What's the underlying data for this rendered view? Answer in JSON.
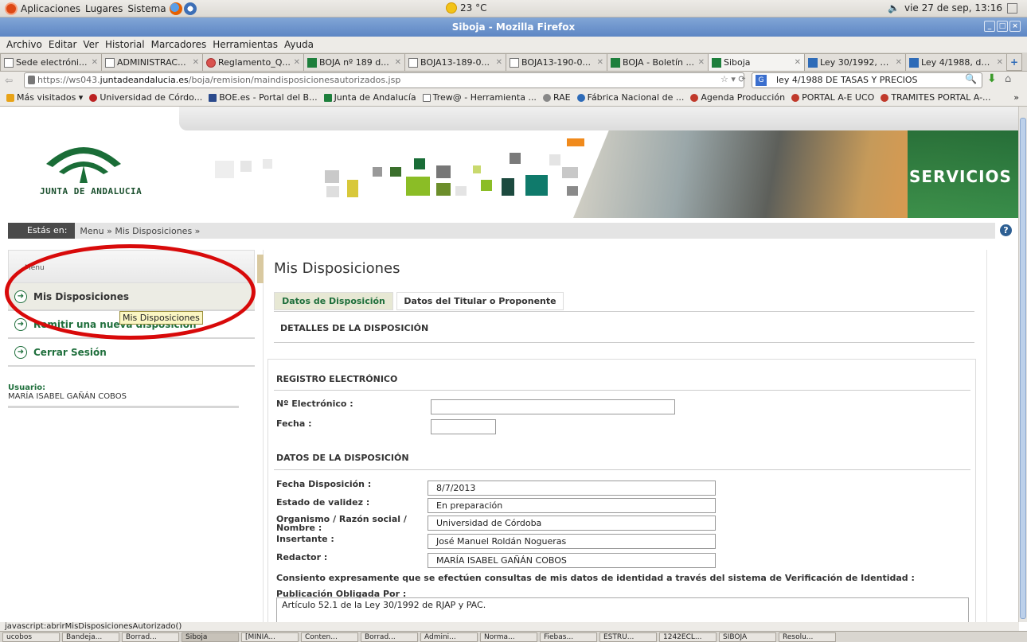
{
  "panel": {
    "menus": [
      "Aplicaciones",
      "Lugares",
      "Sistema"
    ],
    "weather": "23 °C",
    "clock": "vie 27 de sep, 13:16"
  },
  "window": {
    "title": "Siboja - Mozilla Firefox"
  },
  "menubar": [
    "Archivo",
    "Editar",
    "Ver",
    "Historial",
    "Marcadores",
    "Herramientas",
    "Ayuda"
  ],
  "tabs": [
    {
      "label": "Sede electróni...",
      "icon": "page"
    },
    {
      "label": "ADMINISTRAC...",
      "icon": "page"
    },
    {
      "label": "Reglamento_Q...",
      "icon": "pdf"
    },
    {
      "label": "BOJA nº 189 d...",
      "icon": "junta"
    },
    {
      "label": "BOJA13-189-0...",
      "icon": "page"
    },
    {
      "label": "BOJA13-190-0...",
      "icon": "page"
    },
    {
      "label": "BOJA - Boletín ...",
      "icon": "junta"
    },
    {
      "label": "Siboja",
      "icon": "junta",
      "active": true
    },
    {
      "label": "Ley 30/1992, d...",
      "icon": "doc"
    },
    {
      "label": "Ley 4/1988, de ...",
      "icon": "doc"
    }
  ],
  "nav": {
    "url_prefix": "https://ws043.",
    "url_domain": "juntadeandalucia.es",
    "url_rest": "/boja/remision/maindisposicionesautorizados.jsp",
    "search_value": "ley 4/1988 DE TASAS Y PRECIOS"
  },
  "bookmarks": [
    "Más visitados ▾",
    "Universidad de Córdo...",
    "BOE.es - Portal del B...",
    "Junta de Andalucía",
    "Trew@ - Herramienta ...",
    "RAE",
    "Fábrica Nacional de ...",
    "Agenda Producción",
    "PORTAL A-E UCO",
    "TRAMITES PORTAL A-..."
  ],
  "header": {
    "logo_text": "JUNTA DE ANDALUCIA",
    "banner_text": "SERVICIOS"
  },
  "breadcrumb": {
    "label": "Estás en:",
    "path": "Menu » Mis Disposiciones »"
  },
  "sidebar": {
    "menu_title": "Menu",
    "items": [
      {
        "label": "Mis Disposiciones",
        "active": true
      },
      {
        "label": "Remitir una nueva disposición"
      },
      {
        "label": "Cerrar Sesión"
      }
    ],
    "tooltip": "Mis Disposiciones",
    "user_label": "Usuario:",
    "user_name": "MARÍA ISABEL GAÑÁN COBOS"
  },
  "main": {
    "title": "Mis Disposiciones",
    "tabs": [
      "Datos de Disposición",
      "Datos del Titular o Proponente"
    ],
    "section_detalles": "DETALLES DE LA DISPOSICIÓN",
    "section_registro": "REGISTRO ELECTRÓNICO",
    "label_numero": "Nº Electrónico :",
    "value_numero": "",
    "label_fecha": "Fecha :",
    "value_fecha": "",
    "section_datos": "DATOS DE LA DISPOSICIÓN",
    "fields": [
      {
        "label": "Fecha Disposición :",
        "value": "8/7/2013"
      },
      {
        "label": "Estado de validez :",
        "value": "En preparación"
      },
      {
        "label": "Organismo / Razón social / Nombre :",
        "value": "Universidad de Córdoba"
      },
      {
        "label": "Insertante :",
        "value": "José Manuel Roldán Nogueras"
      },
      {
        "label": "Redactor :",
        "value": "MARÍA ISABEL GAÑÁN COBOS"
      }
    ],
    "consent": "Consiento expresamente que se efectúen consultas de mis datos de identidad a través del sistema de Verificación de Identidad :",
    "publication_label": "Publicación Obligada Por :",
    "publication_value": "Artículo 52.1 de la Ley 30/1992 de RJAP y PAC."
  },
  "status": "javascript:abrirMisDisposicionesAutorizado()",
  "taskbar": [
    "ucobos",
    "Bandeja...",
    "Borrad...",
    "Siboja",
    "[MINIA...",
    "Conten...",
    "Borrad...",
    "Admini...",
    "Norma...",
    "Fiebas...",
    "ESTRU...",
    "1242ECL...",
    "SIBOJA",
    "Resolu..."
  ],
  "colors": {
    "junta_green": "#1f6f3c",
    "highlight_red": "#d80a0a"
  }
}
